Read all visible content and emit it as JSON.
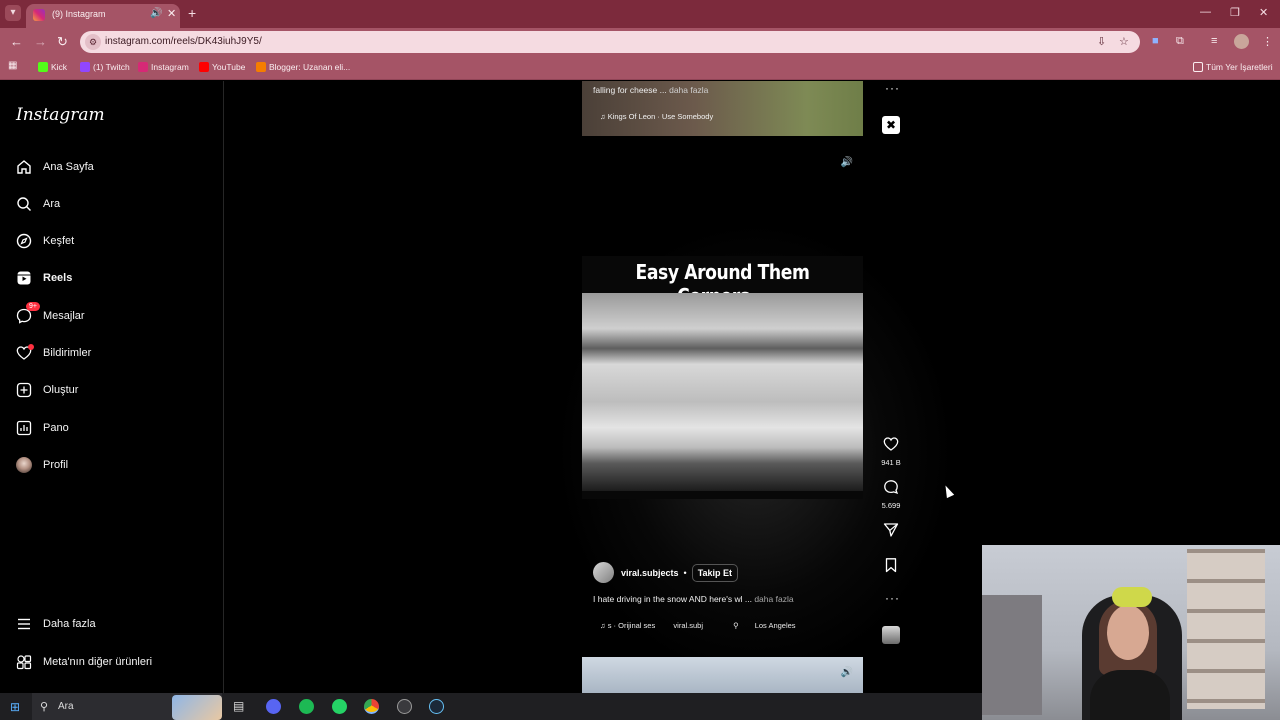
{
  "browser": {
    "tab_title": "(9) Instagram",
    "url": "instagram.com/reels/DK43iuhJ9Y5/",
    "bookmarks": [
      {
        "label": "Kick",
        "color": "#53fc18"
      },
      {
        "label": "(1) Twitch",
        "color": "#9146ff"
      },
      {
        "label": "Instagram",
        "color": "#d62976"
      },
      {
        "label": "YouTube",
        "color": "#ff0000"
      },
      {
        "label": "Blogger: Uzanan eli...",
        "color": "#f57d00"
      }
    ],
    "all_bookmarks": "Tüm Yer İşaretleri"
  },
  "sidebar": {
    "logo": "Instagram",
    "items": [
      {
        "label": "Ana Sayfa",
        "icon": "home-icon"
      },
      {
        "label": "Ara",
        "icon": "search-icon"
      },
      {
        "label": "Keşfet",
        "icon": "compass-icon"
      },
      {
        "label": "Reels",
        "icon": "reels-icon",
        "active": true
      },
      {
        "label": "Mesajlar",
        "icon": "messenger-icon",
        "badge": "9+"
      },
      {
        "label": "Bildirimler",
        "icon": "heart-icon",
        "dot": true
      },
      {
        "label": "Oluştur",
        "icon": "plus-square-icon"
      },
      {
        "label": "Pano",
        "icon": "dashboard-icon"
      },
      {
        "label": "Profil",
        "icon": "profile-avatar"
      }
    ],
    "bottom_items": [
      {
        "label": "Daha fazla",
        "icon": "menu-icon"
      },
      {
        "label": "Meta'nın diğer ürünleri",
        "icon": "meta-products-icon"
      }
    ]
  },
  "previous_reel": {
    "caption": "falling for cheese ...",
    "more": "daha fazla",
    "music": "Kings Of Leon · Use Somebody"
  },
  "current_reel": {
    "overlay_title": "Easy Around Them Corners...",
    "likes": "941 B",
    "comments": "5.699",
    "username": "viral.subjects",
    "separator": "•",
    "follow": "Takip Et",
    "caption": "I hate driving in the snow AND here's wl ...",
    "more": "daha fazla",
    "audio": "s · Orijinal ses",
    "audio_user": "viral.subj",
    "location": "Los Angeles"
  },
  "taskbar": {
    "search_label": "Ara"
  }
}
